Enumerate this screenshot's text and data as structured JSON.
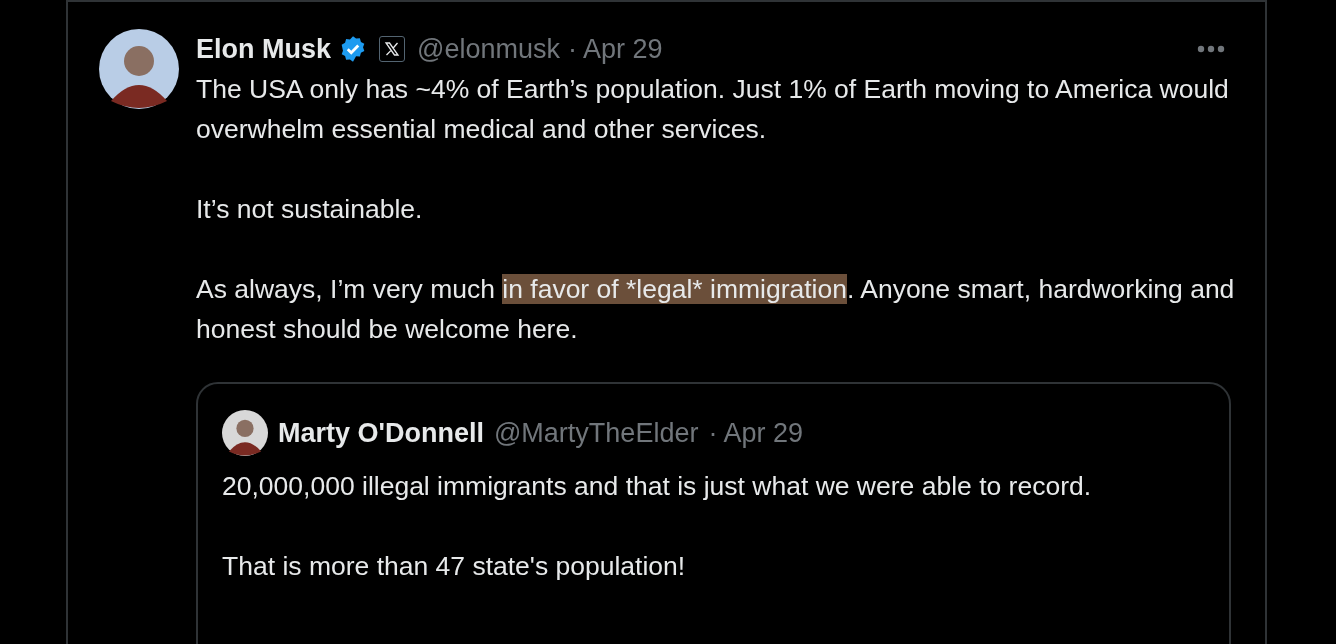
{
  "tweet": {
    "author": {
      "name": "Elon Musk",
      "verified": true,
      "handle": "@elonmusk",
      "date": "· Apr 29"
    },
    "paragraphs": [
      [
        {
          "text": "The USA only has ~4% of Earth’s population. Just 1% of Earth moving to America would overwhelm essential medical and other services.",
          "highlighted": false
        }
      ],
      [
        {
          "text": "It’s not sustainable.",
          "highlighted": false
        }
      ],
      [
        {
          "text": "As always, I’m very much ",
          "highlighted": false
        },
        {
          "text": "in favor of *legal* immigration",
          "highlighted": true
        },
        {
          "text": ". Anyone smart, hardworking and honest should be welcome here.",
          "highlighted": false
        }
      ]
    ],
    "quote": {
      "author": {
        "name": "Marty O'Donnell",
        "handle": "@MartyTheElder",
        "date": "· Apr 29"
      },
      "paragraphs": [
        "20,000,000 illegal immigrants and that is just what we were able to record.",
        "That is more than 47 state's population!"
      ]
    }
  }
}
